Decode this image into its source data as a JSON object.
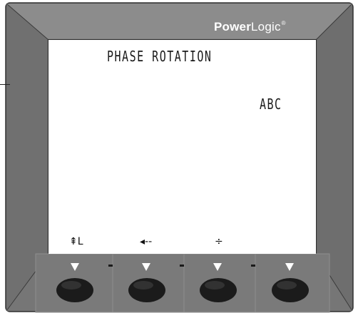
{
  "device": {
    "brand_bold": "Power",
    "brand_light": "Logic",
    "brand_mark": "®"
  },
  "screen": {
    "title": "PHASE ROTATION",
    "value": "ABC"
  },
  "softkeys": [
    {
      "label": "⇞L",
      "icon": "up-level-icon"
    },
    {
      "label": "◂--",
      "icon": "left-arrow-icon"
    },
    {
      "label": "÷",
      "icon": "plus-minus-icon"
    },
    {
      "label": "",
      "icon": "blank"
    }
  ],
  "colors": {
    "bezel_face": "#7a7a7a",
    "bezel_dark": "#5c5c5c",
    "bezel_light": "#8f8f8f",
    "button": "#1c1c1c",
    "lcd": "#ffffff"
  }
}
